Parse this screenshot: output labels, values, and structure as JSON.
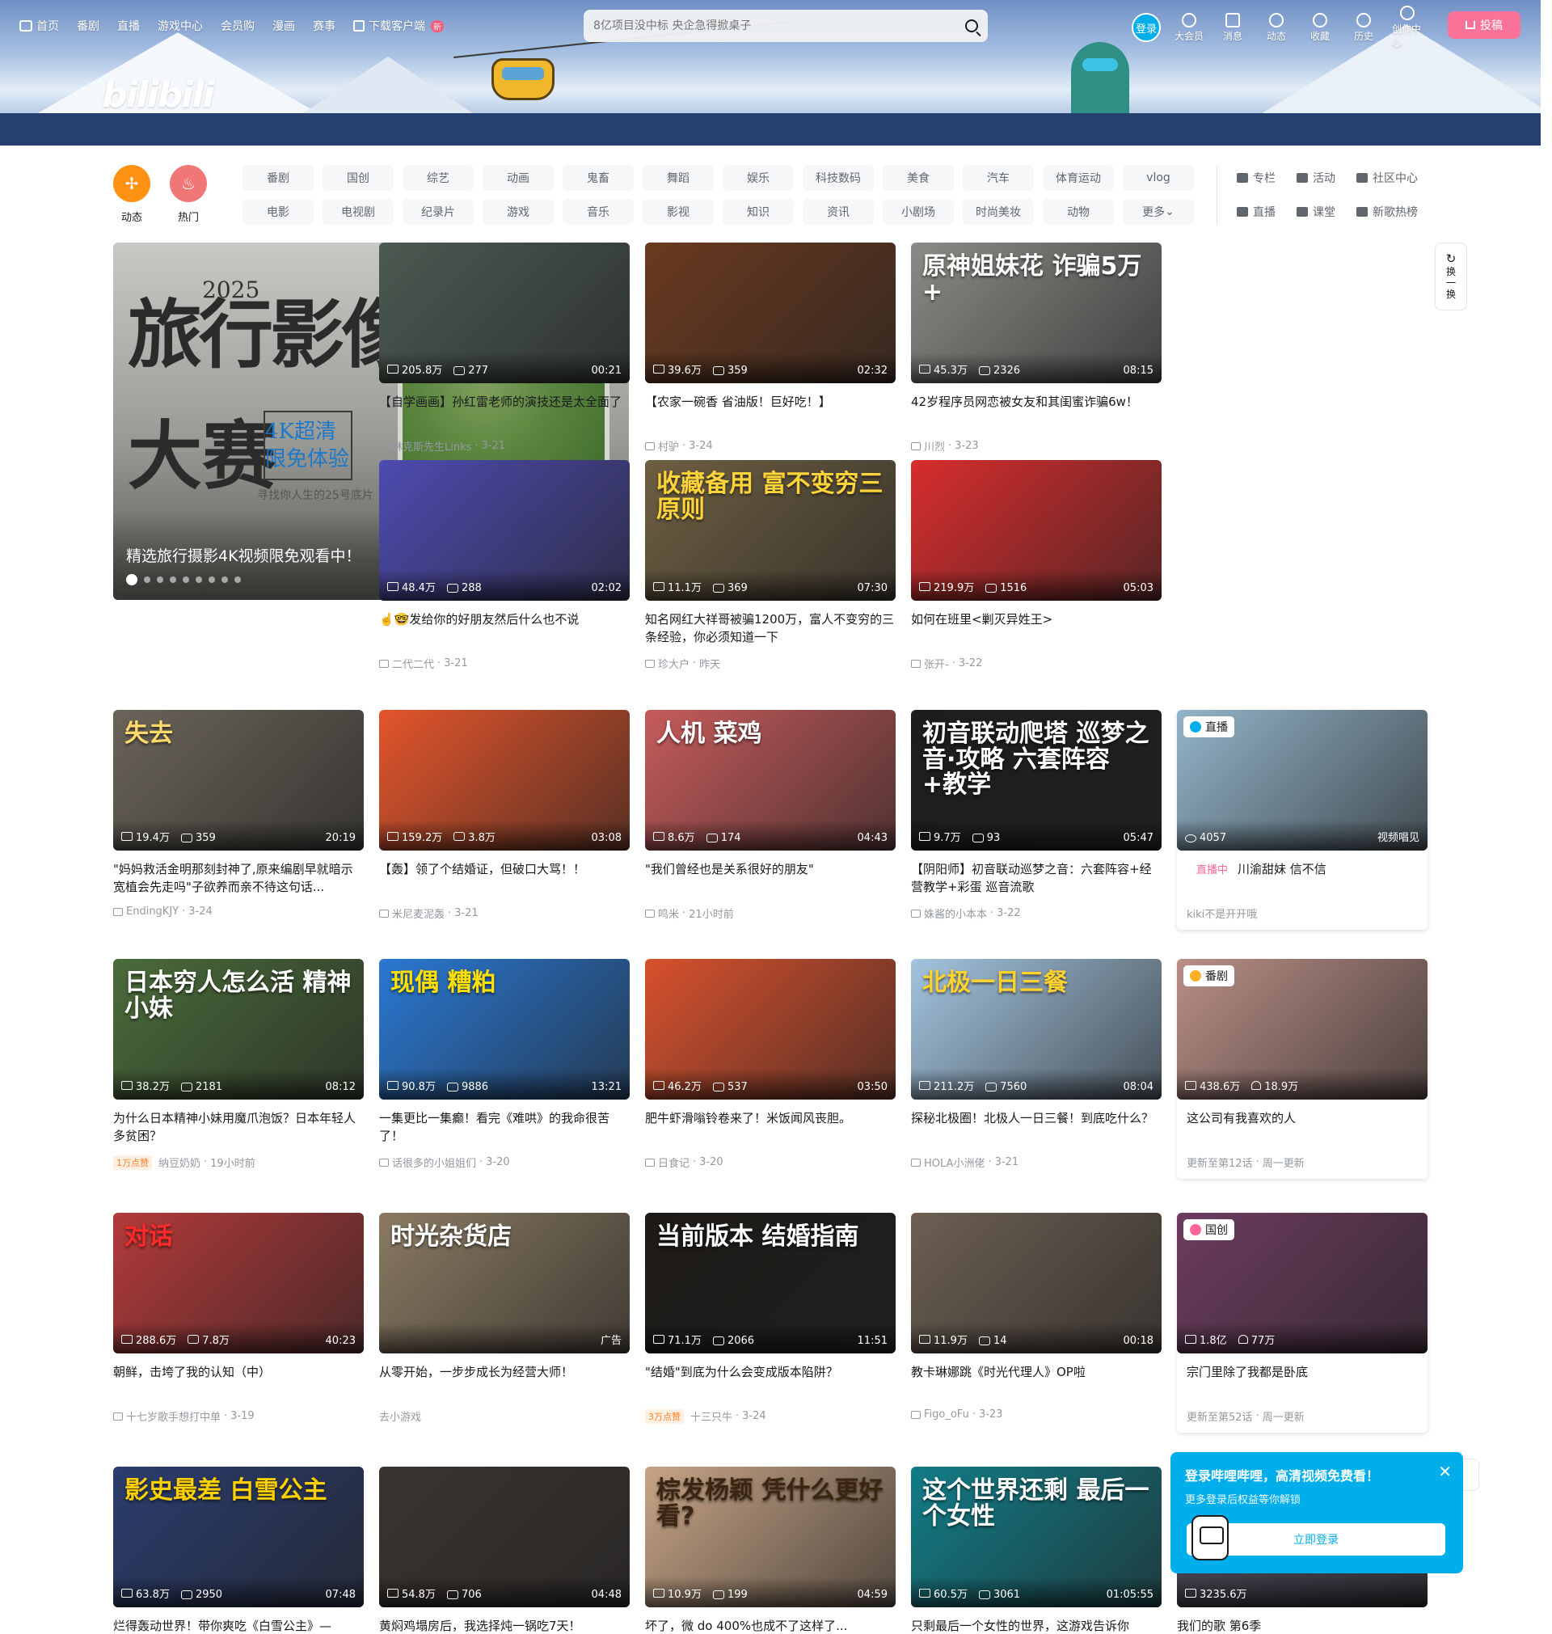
{
  "header": {
    "nav": [
      {
        "label": "首页",
        "icon": "tv-icon"
      },
      {
        "label": "番剧"
      },
      {
        "label": "直播"
      },
      {
        "label": "游戏中心"
      },
      {
        "label": "会员购"
      },
      {
        "label": "漫画"
      },
      {
        "label": "赛事"
      },
      {
        "label": "下载客户端",
        "icon": "download-icon",
        "badge": "新"
      }
    ],
    "search_placeholder": "8亿项目没中标 央企急得掀桌子",
    "login_label": "登录",
    "right_nav": [
      {
        "label": "大会员",
        "icon": "vip-icon"
      },
      {
        "label": "消息",
        "icon": "message-icon"
      },
      {
        "label": "动态",
        "icon": "dynamic-icon"
      },
      {
        "label": "收藏",
        "icon": "favorite-icon"
      },
      {
        "label": "历史",
        "icon": "history-icon"
      },
      {
        "label": "创作中心",
        "icon": "creator-icon"
      }
    ],
    "upload_label": "投稿",
    "logo_text": "bilibili"
  },
  "channels": {
    "icons": [
      {
        "label": "动态",
        "icon": "pinwheel-icon"
      },
      {
        "label": "热门",
        "icon": "flame-icon"
      }
    ],
    "tags": [
      "番剧",
      "国创",
      "综艺",
      "动画",
      "鬼畜",
      "舞蹈",
      "娱乐",
      "科技数码",
      "美食",
      "汽车",
      "体育运动",
      "vlog",
      "电影",
      "电视剧",
      "纪录片",
      "游戏",
      "音乐",
      "影视",
      "知识",
      "资讯",
      "小剧场",
      "时尚美妆",
      "动物",
      "更多"
    ],
    "side_links": [
      {
        "label": "专栏",
        "icon": "column-icon"
      },
      {
        "label": "活动",
        "icon": "activity-icon"
      },
      {
        "label": "社区中心",
        "icon": "community-icon"
      },
      {
        "label": "直播",
        "icon": "live-icon"
      },
      {
        "label": "课堂",
        "icon": "classroom-icon"
      },
      {
        "label": "新歌热榜",
        "icon": "chart-icon"
      }
    ]
  },
  "carousel": {
    "caption": "精选旅行摄影4K视频限免观看中！",
    "poster_year": "2025",
    "poster_line1": "旅行影像",
    "poster_line2": "大赛",
    "poster_chip": "4K超清 限免体验",
    "poster_sub": "寻找你人生的25号底片",
    "poster_brand": "bilibili",
    "dot_count": 9,
    "active_dot": 0
  },
  "refresh": {
    "label": "换一换"
  },
  "cards": [
    {
      "title": "【自学画画】孙红雷老师的演技还是太全面了",
      "up": "林克斯先生Links",
      "date": "3-21",
      "views": "205.8万",
      "comments": "277",
      "duration": "00:21",
      "bg": "#4b5a52"
    },
    {
      "title": "【农家一碗香 省油版！巨好吃！】",
      "up": "村驴",
      "date": "3-24",
      "views": "39.6万",
      "comments": "359",
      "duration": "02:32",
      "bg": "#6b3a1f"
    },
    {
      "title": "42岁程序员网恋被女友和其闺蜜诈骗6w！",
      "up": "川烈",
      "date": "3-23",
      "views": "45.3万",
      "comments": "2326",
      "duration": "08:15",
      "bg": "#8c8a86",
      "thumb_text": "原神姐妹花 诈骗5万+",
      "thumb_color": "#ffffff"
    },
    {
      "title": "☝️🤓发给你的好朋友然后什么也不说",
      "up": "二代二代",
      "date": "3-21",
      "views": "48.4万",
      "comments": "288",
      "duration": "02:02",
      "bg": "#4d4bb0"
    },
    {
      "title": "知名网红大祥哥被骗1200万，富人不变穷的三条经验，你必须知道一下",
      "up": "珍大户",
      "date": "昨天",
      "views": "11.1万",
      "comments": "369",
      "duration": "07:30",
      "bg": "#6e5f42",
      "thumb_text": "收藏备用 富不变穷三原则",
      "thumb_color": "#ffd43a"
    },
    {
      "title": "如何在班里<剿灭异姓王>",
      "up": "张开-",
      "date": "3-22",
      "views": "219.9万",
      "comments": "1516",
      "duration": "05:03",
      "bg": "#d82d2d"
    },
    {
      "title": "\"妈妈救活金明那刻封神了,原来编剧早就暗示宽植会先走吗\"子欲养而亲不待这句话...",
      "up": "EndingKJY",
      "date": "3-24",
      "views": "19.4万",
      "comments": "359",
      "duration": "20:19",
      "bg": "#6a6459",
      "thumb_text": "失去",
      "thumb_color": "#ffd96b"
    },
    {
      "title": "【轰】领了个结婚证，但破口大骂！！",
      "up": "米尼麦泥轰",
      "date": "3-21",
      "views": "159.2万",
      "comments": "3.8万",
      "duration": "03:08",
      "bg": "#e3552b"
    },
    {
      "title": "\"我们曾经也是关系很好的朋友\"",
      "up": "鸣米",
      "date": "21小时前",
      "views": "8.6万",
      "comments": "174",
      "duration": "04:43",
      "bg": "#c65b5b",
      "thumb_text": "人机 菜鸡",
      "thumb_color": "#ffffff"
    },
    {
      "title": "【阴阳师】初音联动巡梦之音：六套阵容+经营教学+彩蛋 巡音流歌",
      "up": "姝酱的小本本",
      "date": "3-22",
      "views": "9.7万",
      "comments": "93",
      "duration": "05:47",
      "bg": "#1d1d1f",
      "thumb_text": "初音联动爬塔 巡梦之音·攻略 六套阵容+教学",
      "thumb_color": "#ffffff"
    },
    {
      "title": "川渝甜妹 信不信",
      "up": "kiki不是开开哦",
      "date": "",
      "views": "4057",
      "comments": "",
      "duration": "视频唱见",
      "bg": "#93b4c9",
      "badge": "直播",
      "live_tag": "直播中",
      "boxed": true
    },
    {
      "title": "为什么日本精神小妹用魔爪泡饭？日本年轻人多贫困？",
      "up": "纳豆奶奶",
      "date": "19小时前",
      "views": "38.2万",
      "comments": "2181",
      "duration": "08:12",
      "bg": "#4a6b3a",
      "thumb_text": "日本穷人怎么活 精神小妹",
      "thumb_color": "#ffffff",
      "hot_tag": "1万点赞"
    },
    {
      "title": "一集更比一集癫！看完《难哄》的我命很苦了！",
      "up": "话很多的小姐姐们",
      "date": "3-20",
      "views": "90.8万",
      "comments": "9886",
      "duration": "13:21",
      "bg": "#2a78d2",
      "thumb_text": "现偶 糟粕",
      "thumb_color": "#ffe000"
    },
    {
      "title": "肥牛虾滑嗡铃卷来了！米饭闻风丧胆。",
      "up": "日食记",
      "date": "3-20",
      "views": "46.2万",
      "comments": "537",
      "duration": "03:50",
      "bg": "#d8512d"
    },
    {
      "title": "探秘北极圈！北极人一日三餐！到底吃什么？",
      "up": "HOLA小洲佬",
      "date": "3-21",
      "views": "211.2万",
      "comments": "7560",
      "duration": "08:04",
      "bg": "#a3c4df",
      "thumb_text": "北极一日三餐",
      "thumb_color": "#ffd22e"
    },
    {
      "title": "这公司有我喜欢的人",
      "up": "更新至第12话",
      "date": "周一更新",
      "views": "438.6万",
      "comments": "18.9万",
      "duration": "",
      "bg": "#b98e86",
      "badge": "番剧",
      "boxed": true,
      "heart": true
    },
    {
      "title": "朝鲜，击垮了我的认知（中）",
      "up": "十七岁歌手想打中单",
      "date": "3-19",
      "views": "288.6万",
      "comments": "7.8万",
      "duration": "40:23",
      "bg": "#b33a3a",
      "thumb_text": "对话",
      "thumb_color": "#ff2a2a"
    },
    {
      "title": "从零开始，一步步成长为经营大师！",
      "up": "去小游戏",
      "date": "",
      "views": "",
      "comments": "",
      "duration": "广告",
      "bg": "#8a7a62",
      "thumb_text": "时光杂货店",
      "thumb_color": "#ffffff",
      "ad": true
    },
    {
      "title": "\"结婚\"到底为什么会变成版本陷阱？",
      "up": "十三只牛",
      "date": "3-24",
      "views": "71.1万",
      "comments": "2066",
      "duration": "11:51",
      "bg": "#1d1a17",
      "thumb_text": "当前版本 结婚指南",
      "thumb_color": "#ffffff",
      "hot_tag": "3万点赞"
    },
    {
      "title": "教卡琳娜跳《时光代理人》OP啦",
      "up": "Figo_oFu",
      "date": "3-23",
      "views": "11.9万",
      "comments": "14",
      "duration": "00:18",
      "bg": "#6d5f52"
    },
    {
      "title": "宗门里除了我都是卧底",
      "up": "更新至第52话",
      "date": "周一更新",
      "views": "1.8亿",
      "comments": "77万",
      "duration": "",
      "bg": "#6d3c5f",
      "badge": "国创",
      "boxed": true,
      "heart": true
    },
    {
      "title": "烂得轰动世界！带你爽吃《白雪公主》—",
      "up": "",
      "date": "",
      "views": "63.8万",
      "comments": "2950",
      "duration": "07:48",
      "bg": "#2b3d6e",
      "thumb_text": "影史最差 白雪公主",
      "thumb_color": "#ffd000"
    },
    {
      "title": "黄焖鸡塌房后，我选择炖一锅吃7天！",
      "up": "",
      "date": "",
      "views": "54.8万",
      "comments": "706",
      "duration": "04:48",
      "bg": "#3a3430"
    },
    {
      "title": "坏了，微 do 400%也成不了这样了...",
      "up": "",
      "date": "",
      "views": "10.9万",
      "comments": "199",
      "duration": "04:59",
      "bg": "#c7a486",
      "thumb_text": "棕发杨颖 凭什么更好看?",
      "thumb_color": "#3b2410"
    },
    {
      "title": "只剩最后一个女性的世界，这游戏告诉你",
      "up": "",
      "date": "",
      "views": "60.5万",
      "comments": "3061",
      "duration": "01:05:55",
      "bg": "#127c87",
      "thumb_text": "这个世界还剩 最后一个女性",
      "thumb_color": "#ffffff"
    },
    {
      "title": "我们的歌 第6季",
      "up": "",
      "date": "",
      "views": "3235.6万",
      "comments": "",
      "duration": "",
      "bg": "#4a4a5a"
    }
  ],
  "login_popup": {
    "title": "登录哔哩哔哩，高清视频免费看！",
    "subtitle": "更多登录后权益等你解锁",
    "button": "立即登录"
  }
}
